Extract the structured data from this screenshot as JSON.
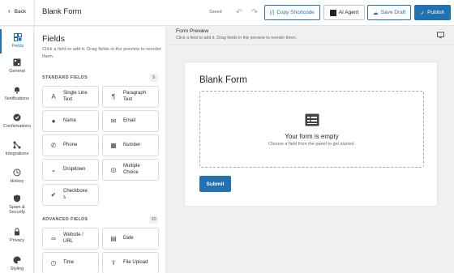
{
  "topbar": {
    "back_label": "Back",
    "form_title": "Blank Form",
    "status": "Saved",
    "copy_shortcode": "Copy Shortcode",
    "ai_agent": "AI Agent",
    "save_draft": "Save Draft",
    "publish": "Publish"
  },
  "rail": [
    {
      "label": "Fields",
      "icon": "fields-icon"
    },
    {
      "label": "General",
      "icon": "general-icon"
    },
    {
      "label": "Notifications",
      "icon": "bell-icon"
    },
    {
      "label": "Confirmations",
      "icon": "check-circle-icon"
    },
    {
      "label": "Integrations",
      "icon": "integrations-icon"
    },
    {
      "label": "History",
      "icon": "history-icon"
    },
    {
      "label": "Spam &",
      "label2": "Security",
      "icon": "shield-icon"
    },
    {
      "label": "Privacy",
      "icon": "lock-icon"
    },
    {
      "label": "Styling",
      "icon": "palette-icon"
    }
  ],
  "panel": {
    "title": "Fields",
    "description": "Click a field to add it. Drag fields in the preview to reorder them.",
    "standard": {
      "label": "STANDARD FIELDS",
      "count": "9",
      "items": [
        {
          "label": "Single Line",
          "label2": "Text",
          "icon": "text-icon"
        },
        {
          "label": "Paragraph",
          "label2": "Text",
          "icon": "paragraph-icon"
        },
        {
          "label": "Name",
          "label2": "",
          "icon": "person-icon"
        },
        {
          "label": "Email",
          "label2": "",
          "icon": "envelope-icon"
        },
        {
          "label": "Phone",
          "label2": "",
          "icon": "phone-icon"
        },
        {
          "label": "Number",
          "label2": "",
          "icon": "number-icon"
        },
        {
          "label": "Dropdown",
          "label2": "",
          "icon": "chevron-down-icon"
        },
        {
          "label": "Multiple",
          "label2": "Choice",
          "icon": "radio-icon"
        },
        {
          "label": "Checkboxe",
          "label2": "s",
          "icon": "checkbox-icon"
        }
      ]
    },
    "advanced": {
      "label": "ADVANCED FIELDS",
      "count": "10",
      "items": [
        {
          "label": "Website /",
          "label2": "URL",
          "icon": "link-icon"
        },
        {
          "label": "Date",
          "label2": "",
          "icon": "calendar-icon"
        },
        {
          "label": "Time",
          "label2": "",
          "icon": "clock-icon"
        },
        {
          "label": "File Upload",
          "label2": "",
          "icon": "upload-icon"
        }
      ]
    }
  },
  "preview": {
    "title": "Form Preview",
    "subtitle": "Click a field to add it. Drag fields in the preview to reorder them.",
    "form_title": "Blank Form",
    "empty_title": "Your form is empty",
    "empty_sub": "Choose a field from the panel to get started.",
    "submit": "Submit"
  },
  "colors": {
    "accent": "#2271b1",
    "background": "#f0f0f1"
  }
}
